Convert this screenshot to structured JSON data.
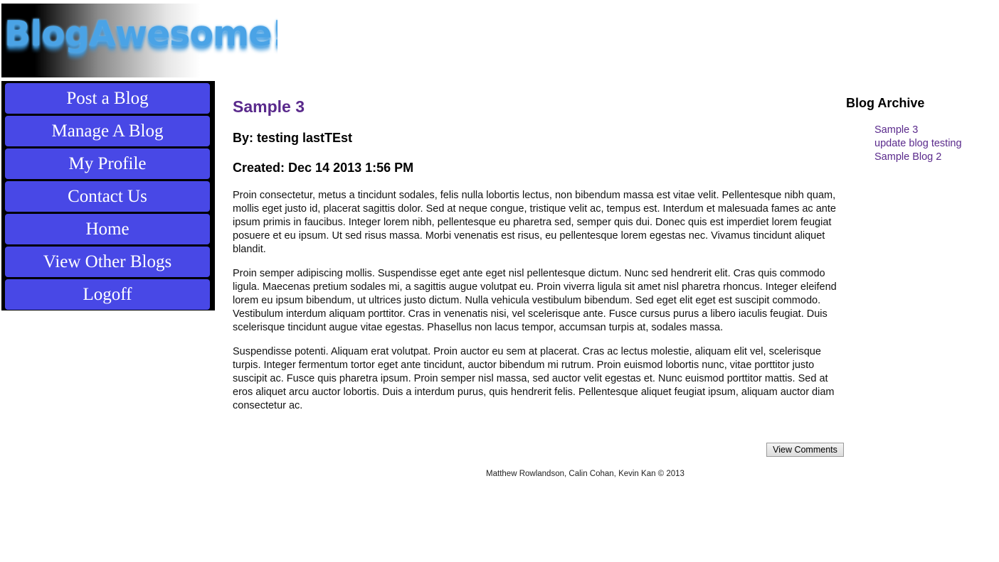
{
  "header": {
    "logo_text": "BlogAwesome!"
  },
  "nav": {
    "items": [
      {
        "label": "Post a Blog"
      },
      {
        "label": "Manage A Blog"
      },
      {
        "label": "My Profile"
      },
      {
        "label": "Contact Us"
      },
      {
        "label": "Home"
      },
      {
        "label": "View Other Blogs"
      },
      {
        "label": "Logoff"
      }
    ]
  },
  "post": {
    "title": "Sample 3",
    "author": "By: testing lastTEst",
    "created": "Created: Dec 14 2013 1:56 PM",
    "paragraphs": [
      "Proin consectetur, metus a tincidunt sodales, felis nulla lobortis lectus, non bibendum massa est vitae velit. Pellentesque nibh quam, mollis eget justo id, placerat sagittis dolor. Sed at neque congue, tristique velit ac, tempus est. Interdum et malesuada fames ac ante ipsum primis in faucibus. Integer lorem nibh, pellentesque eu pharetra sed, semper quis dui. Donec quis est imperdiet lorem feugiat posuere et eu ipsum. Ut sed risus massa. Morbi venenatis est risus, eu pellentesque lorem egestas nec. Vivamus tincidunt aliquet blandit.",
      "Proin semper adipiscing mollis. Suspendisse eget ante eget nisl pellentesque dictum. Nunc sed hendrerit elit. Cras quis commodo ligula. Maecenas pretium sodales mi, a sagittis augue volutpat eu. Proin viverra ligula sit amet nisl pharetra rhoncus. Integer eleifend lorem eu ipsum bibendum, ut ultrices justo dictum. Nulla vehicula vestibulum bibendum. Sed eget elit eget est suscipit commodo. Vestibulum interdum aliquam porttitor. Cras in venenatis nisi, vel scelerisque ante. Fusce cursus purus a libero iaculis feugiat. Duis scelerisque tincidunt augue vitae egestas. Phasellus non lacus tempor, accumsan turpis at, sodales massa.",
      "Suspendisse potenti. Aliquam erat volutpat. Proin auctor eu sem at placerat. Cras ac lectus molestie, aliquam elit vel, scelerisque turpis. Integer fermentum tortor eget ante tincidunt, auctor bibendum mi rutrum. Proin euismod lobortis nunc, vitae porttitor justo suscipit ac. Fusce quis pharetra ipsum. Proin semper nisl massa, sed auctor velit egestas et. Nunc euismod porttitor mattis. Sed at eros aliquet arcu auctor lobortis. Duis a interdum purus, quis hendrerit felis. Pellentesque aliquet feugiat ipsum, aliquam auctor diam consectetur ac."
    ],
    "view_comments_label": "View Comments"
  },
  "archive": {
    "title": "Blog Archive",
    "items": [
      {
        "label": "Sample 3"
      },
      {
        "label": "update blog testing"
      },
      {
        "label": "Sample Blog 2"
      }
    ]
  },
  "footer": {
    "text": "Matthew Rowlandson, Calin Cohan, Kevin Kan © 2013"
  },
  "colors": {
    "nav_button": "#4848e6",
    "link_purple": "#5a2a8c",
    "logo_blue": "#4aa3e6"
  }
}
